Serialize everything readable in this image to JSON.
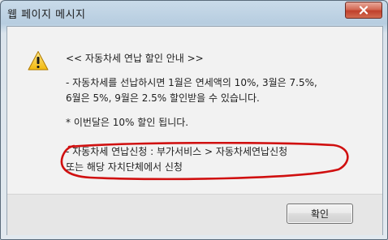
{
  "window": {
    "title": "웹 페이지 메시지"
  },
  "message": {
    "heading": "<< 자동차세 연납 할인 안내 >>",
    "line1": "- 자동차세를 선납하시면 1월은 연세액의 10%, 3월은 7.5%,",
    "line2": "6월은 5%, 9월은 2.5% 할인받을 수 있습니다.",
    "line3": "* 이번달은 10% 할인 됩니다.",
    "line4": "- 자동차세 연납신청 : 부가서비스 > 자동차세연납신청",
    "line5": "또는 해당 자치단체에서 신청"
  },
  "buttons": {
    "ok_label": "확인"
  },
  "colors": {
    "annotation_circle": "#d01010",
    "close_button": "#c0402b"
  }
}
